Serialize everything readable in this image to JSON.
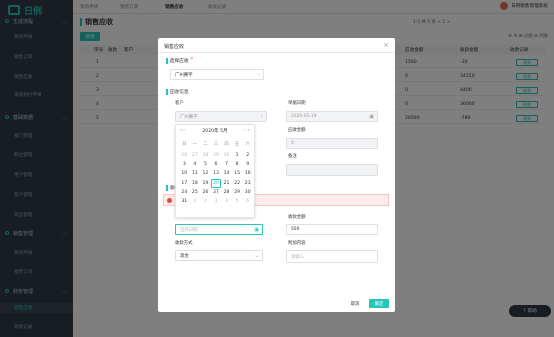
{
  "app": {
    "logo_text": "日例"
  },
  "sidebar": {
    "groups": [
      {
        "label": "生成流程",
        "items": [
          "我的申请",
          "销售订单",
          "销售应收",
          "采购到付申请"
        ]
      },
      {
        "label": "基础数据",
        "items": [
          "部门管理",
          "职位管理",
          "用户管理",
          "客户管理",
          "商品管理"
        ]
      },
      {
        "label": "销售管理",
        "items": [
          "我的申请",
          "销售订单"
        ]
      },
      {
        "label": "财务管理",
        "items": [
          "销售应收",
          "收款记录"
        ]
      }
    ],
    "active_item": "销售应收"
  },
  "topbar": {
    "tabs": [
      "我的申请",
      "销售订单",
      "销售应收",
      "收款记录"
    ],
    "active_tab": "销售应收",
    "user_name": "日例销售管理系统"
  },
  "page": {
    "title": "销售应收",
    "add_button": "新增",
    "pager_text": "1-5 共 5 条  < 1 >",
    "tools_text": "⟳  ☰  ⊞  分组  ⊟ 列表",
    "columns": [
      "序号",
      "收款",
      "客户",
      "应收金额",
      "账龄金额",
      "收款记录"
    ],
    "rows": [
      {
        "no": "1",
        "amount": "1560",
        "ageing": "-30",
        "action": "收款"
      },
      {
        "no": "2",
        "amount": "0",
        "ageing": "34150",
        "action": "收款"
      },
      {
        "no": "3",
        "amount": "0",
        "ageing": "4400",
        "action": "收款"
      },
      {
        "no": "4",
        "amount": "0",
        "ageing": "36000",
        "action": "收款"
      },
      {
        "no": "5",
        "amount": "20590",
        "ageing": "-789",
        "action": "收款"
      }
    ],
    "float_button": "帮助"
  },
  "modal": {
    "title": "销售应收",
    "close": "×",
    "sec_source": "选择应收",
    "source_value": "广州赛宇",
    "sec_info": "应收信息",
    "label_customer": "客户",
    "customer_value": "广州赛宇",
    "label_date": "单据日期",
    "date_value": "2020-05-19",
    "label_amount": "应收金额",
    "amount_value": "0",
    "label_remark": "备注",
    "sec_collect": "收款信息",
    "error_text": "",
    "date_placeholder": "选择日期",
    "label_collect_amount": "收款金额",
    "collect_amount_value": "500",
    "label_method": "收款方式",
    "method_value": "现金",
    "label_attach": "附加内容",
    "attach_placeholder": "请输入",
    "cancel": "取消",
    "confirm": "确定"
  },
  "calendar": {
    "header": "2020年 5月",
    "nav_prev": "«  ‹",
    "nav_next": "›  »",
    "weekdays": [
      "日",
      "一",
      "二",
      "三",
      "四",
      "五",
      "六"
    ],
    "days": [
      "26",
      "27",
      "28",
      "29",
      "30",
      "1",
      "2",
      "3",
      "4",
      "5",
      "6",
      "7",
      "8",
      "9",
      "10",
      "11",
      "12",
      "13",
      "14",
      "15",
      "16",
      "17",
      "18",
      "19",
      "20",
      "21",
      "22",
      "23",
      "24",
      "25",
      "26",
      "27",
      "28",
      "29",
      "30",
      "31",
      "1",
      "2",
      "3",
      "4",
      "5",
      "6"
    ],
    "selected_day": "20"
  },
  "colors": {
    "accent": "#25c7b7",
    "sidebar_bg": "#2f3a46",
    "error": "#e8463b"
  }
}
